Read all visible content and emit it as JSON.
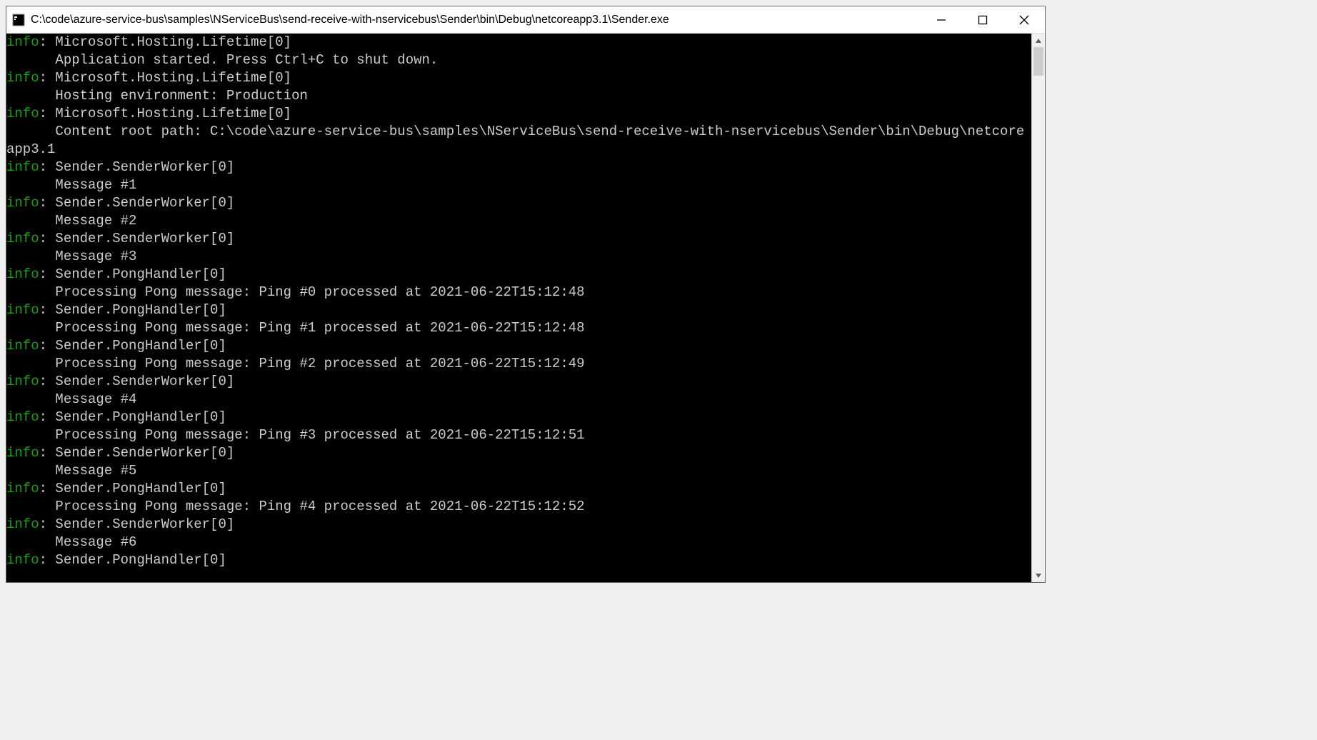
{
  "window": {
    "title": "C:\\code\\azure-service-bus\\samples\\NServiceBus\\send-receive-with-nservicebus\\Sender\\bin\\Debug\\netcoreapp3.1\\Sender.exe"
  },
  "log": {
    "level_label": "info",
    "separator": ": ",
    "body_indent": "      ",
    "entries": [
      {
        "source": "Microsoft.Hosting.Lifetime[0]",
        "body": "Application started. Press Ctrl+C to shut down."
      },
      {
        "source": "Microsoft.Hosting.Lifetime[0]",
        "body": "Hosting environment: Production"
      },
      {
        "source": "Microsoft.Hosting.Lifetime[0]",
        "body": "Content root path: C:\\code\\azure-service-bus\\samples\\NServiceBus\\send-receive-with-nservicebus\\Sender\\bin\\Debug\\netcoreapp3.1"
      },
      {
        "source": "Sender.SenderWorker[0]",
        "body": "Message #1"
      },
      {
        "source": "Sender.SenderWorker[0]",
        "body": "Message #2"
      },
      {
        "source": "Sender.SenderWorker[0]",
        "body": "Message #3"
      },
      {
        "source": "Sender.PongHandler[0]",
        "body": "Processing Pong message: Ping #0 processed at 2021-06-22T15:12:48"
      },
      {
        "source": "Sender.PongHandler[0]",
        "body": "Processing Pong message: Ping #1 processed at 2021-06-22T15:12:48"
      },
      {
        "source": "Sender.PongHandler[0]",
        "body": "Processing Pong message: Ping #2 processed at 2021-06-22T15:12:49"
      },
      {
        "source": "Sender.SenderWorker[0]",
        "body": "Message #4"
      },
      {
        "source": "Sender.PongHandler[0]",
        "body": "Processing Pong message: Ping #3 processed at 2021-06-22T15:12:51"
      },
      {
        "source": "Sender.SenderWorker[0]",
        "body": "Message #5"
      },
      {
        "source": "Sender.PongHandler[0]",
        "body": "Processing Pong message: Ping #4 processed at 2021-06-22T15:12:52"
      },
      {
        "source": "Sender.SenderWorker[0]",
        "body": "Message #6"
      },
      {
        "source": "Sender.PongHandler[0]",
        "body": ""
      }
    ]
  }
}
